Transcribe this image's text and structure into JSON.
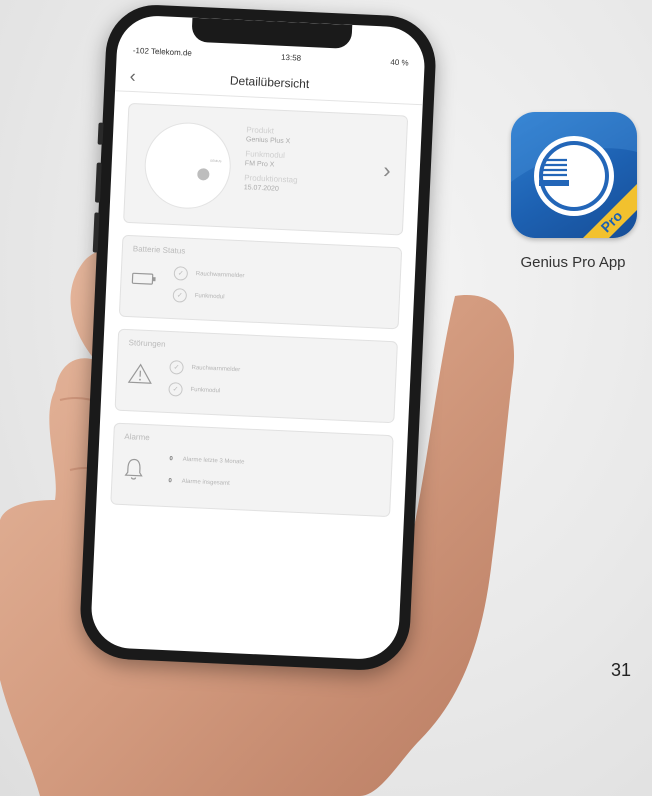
{
  "phone": {
    "status": {
      "carrier": "-102 Telekom.de",
      "time": "13:58",
      "battery": "40 %"
    },
    "nav": {
      "title": "Detailübersicht"
    },
    "product": {
      "labels": [
        "Produkt",
        "Funkmodul",
        "Produktionstag"
      ],
      "values": [
        "Genius Plus X",
        "FM Pro X",
        "15.07.2020"
      ],
      "device_label": "GENIUS"
    },
    "battery_status": {
      "title": "Batterie Status",
      "items": [
        "Rauchwarnmelder",
        "Funkmodul"
      ]
    },
    "faults": {
      "title": "Störungen",
      "items": [
        "Rauchwarnmelder",
        "Funkmodul"
      ]
    },
    "alarms": {
      "title": "Alarme",
      "items": [
        {
          "count": "0",
          "label": "Alarme letzte 3 Monate"
        },
        {
          "count": "0",
          "label": "Alarme insgesamt"
        }
      ]
    }
  },
  "app_icon": {
    "caption": "Genius Pro App",
    "ribbon": "Pro"
  },
  "page_number": "31",
  "colors": {
    "icon_blue": "#1d61b2",
    "ribbon_yellow": "#f2c12e"
  }
}
